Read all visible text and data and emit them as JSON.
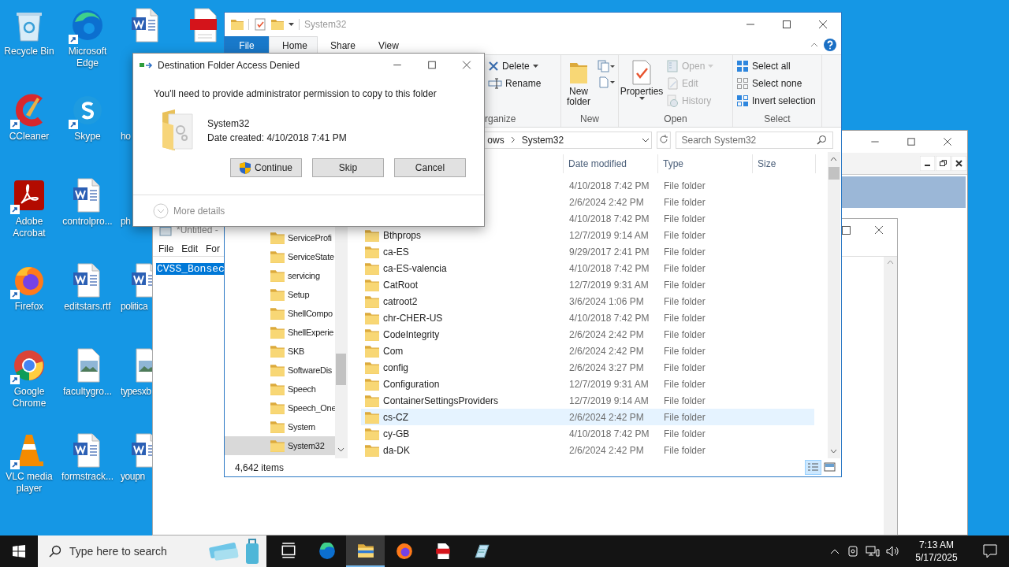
{
  "desktop": {
    "columns": [
      [
        {
          "label": "Recycle Bin",
          "kind": "recycle",
          "shortcut": false
        },
        {
          "label": "CCleaner",
          "kind": "ccleaner",
          "shortcut": true
        },
        {
          "label": "Adobe Acrobat",
          "kind": "acrobat",
          "shortcut": true
        },
        {
          "label": "Firefox",
          "kind": "firefox",
          "shortcut": true
        },
        {
          "label": "Google Chrome",
          "kind": "chrome",
          "shortcut": true
        },
        {
          "label": "VLC media player",
          "kind": "vlc",
          "shortcut": true
        }
      ],
      [
        {
          "label": "Microsoft Edge",
          "kind": "edge",
          "shortcut": true
        },
        {
          "label": "Skype",
          "kind": "skype",
          "shortcut": true
        },
        {
          "label": "controlpro...",
          "kind": "word",
          "shortcut": false
        },
        {
          "label": "editstars.rtf",
          "kind": "word",
          "shortcut": false
        },
        {
          "label": "facultygro...",
          "kind": "image",
          "shortcut": false
        },
        {
          "label": "formstrack...",
          "kind": "word",
          "shortcut": false
        }
      ],
      [
        {
          "kind": "word",
          "shortcut": false
        },
        {
          "label": "ho",
          "shortcut": false
        },
        {
          "label": "ph",
          "shortcut": false
        },
        {
          "label": "politica",
          "kind": "word",
          "shortcut": false
        },
        {
          "label": "typesxb",
          "kind": "image",
          "shortcut": false
        },
        {
          "label": "youpn",
          "kind": "word",
          "shortcut": false
        }
      ],
      [
        {
          "kind": "pdf",
          "shortcut": false
        }
      ]
    ]
  },
  "notepad": {
    "title": "*Untitled - ",
    "menu": [
      "File",
      "Edit",
      "For"
    ],
    "text": "CVSS_Bonsec",
    "text_selected": true
  },
  "explorer": {
    "title": "System32",
    "tabs": [
      {
        "label": "File",
        "kind": "file",
        "selected": false
      },
      {
        "label": "Home",
        "kind": "tab",
        "selected": true
      },
      {
        "label": "Share",
        "kind": "tab",
        "selected": false
      },
      {
        "label": "View",
        "kind": "tab",
        "selected": false
      }
    ],
    "ribbon": {
      "groups": [
        {
          "label": "rganize",
          "items": [
            {
              "label": "Delete",
              "kind": "delete",
              "disabled": false
            },
            {
              "label": "Rename",
              "kind": "rename",
              "disabled": false
            }
          ]
        },
        {
          "label": "New",
          "items": [
            {
              "label": "New folder",
              "kind": "new_folder",
              "disabled": false
            }
          ]
        },
        {
          "label": "Open",
          "items": [
            {
              "label": "Properties",
              "kind": "properties",
              "disabled": false
            },
            {
              "label": "Open",
              "kind": "open",
              "disabled": true
            },
            {
              "label": "Edit",
              "kind": "edit",
              "disabled": true
            },
            {
              "label": "History",
              "kind": "history",
              "disabled": true
            }
          ]
        },
        {
          "label": "Select",
          "items": [
            {
              "label": "Select all",
              "kind": "select_all",
              "disabled": false
            },
            {
              "label": "Select none",
              "kind": "select_none",
              "disabled": false
            },
            {
              "label": "Invert selection",
              "kind": "invert",
              "disabled": false
            }
          ]
        }
      ]
    },
    "path": [
      "ows",
      "System32"
    ],
    "search": {
      "placeholder": "Search System32"
    },
    "nav": [
      {
        "label": "ServiceProfi",
        "selected": false
      },
      {
        "label": "ServiceState",
        "selected": false
      },
      {
        "label": "servicing",
        "selected": false
      },
      {
        "label": "Setup",
        "selected": false
      },
      {
        "label": "ShellCompo",
        "selected": false
      },
      {
        "label": "ShellExperie",
        "selected": false
      },
      {
        "label": "SKB",
        "selected": false
      },
      {
        "label": "SoftwareDis",
        "selected": false
      },
      {
        "label": "Speech",
        "selected": false
      },
      {
        "label": "Speech_One",
        "selected": false
      },
      {
        "label": "System",
        "selected": false
      },
      {
        "label": "System32",
        "selected": true
      }
    ],
    "columns": [
      "Date modified",
      "Type",
      "Size"
    ],
    "rows": [
      {
        "date": "4/10/2018 7:42 PM",
        "type": "File folder",
        "selected": false
      },
      {
        "date": "2/6/2024 2:42 PM",
        "type": "File folder",
        "selected": false
      },
      {
        "date": "4/10/2018 7:42 PM",
        "type": "File folder",
        "selected": false
      },
      {
        "name": "Bthprops",
        "date": "12/7/2019 9:14 AM",
        "type": "File folder",
        "selected": false
      },
      {
        "name": "ca-ES",
        "date": "9/29/2017 2:41 PM",
        "type": "File folder",
        "selected": false
      },
      {
        "name": "ca-ES-valencia",
        "date": "4/10/2018 7:42 PM",
        "type": "File folder",
        "selected": false
      },
      {
        "name": "CatRoot",
        "date": "12/7/2019 9:31 AM",
        "type": "File folder",
        "selected": false
      },
      {
        "name": "catroot2",
        "date": "3/6/2024 1:06 PM",
        "type": "File folder",
        "selected": false
      },
      {
        "name": "chr-CHER-US",
        "date": "4/10/2018 7:42 PM",
        "type": "File folder",
        "selected": false
      },
      {
        "name": "CodeIntegrity",
        "date": "2/6/2024 2:42 PM",
        "type": "File folder",
        "selected": false
      },
      {
        "name": "Com",
        "date": "2/6/2024 2:42 PM",
        "type": "File folder",
        "selected": false
      },
      {
        "name": "config",
        "date": "2/6/2024 3:27 PM",
        "type": "File folder",
        "selected": false
      },
      {
        "name": "Configuration",
        "date": "12/7/2019 9:31 AM",
        "type": "File folder",
        "selected": false
      },
      {
        "name": "ContainerSettingsProviders",
        "date": "12/7/2019 9:14 AM",
        "type": "File folder",
        "selected": false
      },
      {
        "name": "cs-CZ",
        "date": "2/6/2024 2:42 PM",
        "type": "File folder",
        "selected": true
      },
      {
        "name": "cy-GB",
        "date": "4/10/2018 7:42 PM",
        "type": "File folder",
        "selected": false
      },
      {
        "name": "da-DK",
        "date": "2/6/2024 2:42 PM",
        "type": "File folder",
        "selected": false
      }
    ],
    "status": "4,642 items"
  },
  "dialog": {
    "title": "Destination Folder Access Denied",
    "message": "You'll need to provide administrator permission to copy to this folder",
    "item_name": "System32",
    "item_date": "Date created: 4/10/2018 7:41 PM",
    "buttons": [
      {
        "label": "Continue",
        "kind": "elevated"
      },
      {
        "label": "Skip",
        "kind": "plain"
      },
      {
        "label": "Cancel",
        "kind": "plain"
      }
    ],
    "more_details": "More details"
  },
  "taskbar": {
    "search_placeholder": "Type here to search",
    "apps": [
      {
        "kind": "taskview",
        "active": false
      },
      {
        "kind": "edge",
        "active": false
      },
      {
        "kind": "explorer",
        "active": true
      },
      {
        "kind": "firefox",
        "active": false
      },
      {
        "kind": "pdf",
        "active": false
      },
      {
        "kind": "notepad",
        "active": false
      }
    ],
    "time": "7:13 AM",
    "date": "5/17/2025"
  }
}
